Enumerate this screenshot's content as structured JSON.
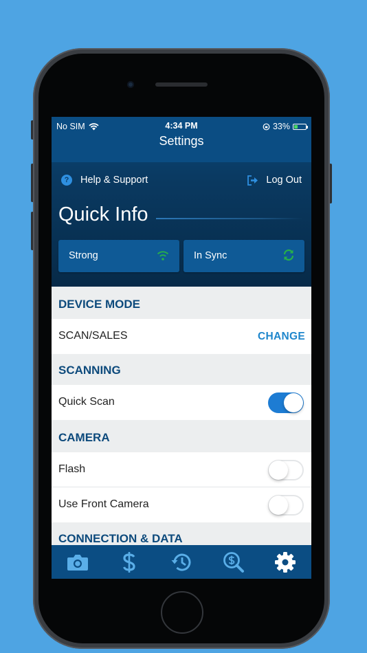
{
  "status_bar": {
    "carrier": "No SIM",
    "time": "4:34 PM",
    "battery_percent": "33%",
    "battery_level": 0.33
  },
  "nav": {
    "title": "Settings"
  },
  "header_actions": {
    "help_label": "Help & Support",
    "logout_label": "Log Out"
  },
  "quick_info": {
    "title": "Quick Info",
    "signal_label": "Strong",
    "sync_label": "In Sync"
  },
  "sections": {
    "device_mode": {
      "title": "DEVICE MODE",
      "mode_value": "SCAN/SALES",
      "change_label": "CHANGE"
    },
    "scanning": {
      "title": "SCANNING",
      "quick_scan_label": "Quick Scan",
      "quick_scan_on": true
    },
    "camera": {
      "title": "CAMERA",
      "flash_label": "Flash",
      "flash_on": false,
      "front_camera_label": "Use Front Camera",
      "front_camera_on": false
    },
    "connection": {
      "title": "CONNECTION & DATA"
    }
  },
  "tabs": [
    "camera-icon",
    "dollar-icon",
    "history-icon",
    "price-search-icon",
    "gear-icon"
  ],
  "colors": {
    "background": "#4ea4e3",
    "navbar": "#0b4d83",
    "accent": "#1d7cd3",
    "section_text": "#0d4a7c",
    "status_green": "#27b04a",
    "active_tab": "#ffffff",
    "inactive_tab": "#5aaee8"
  }
}
